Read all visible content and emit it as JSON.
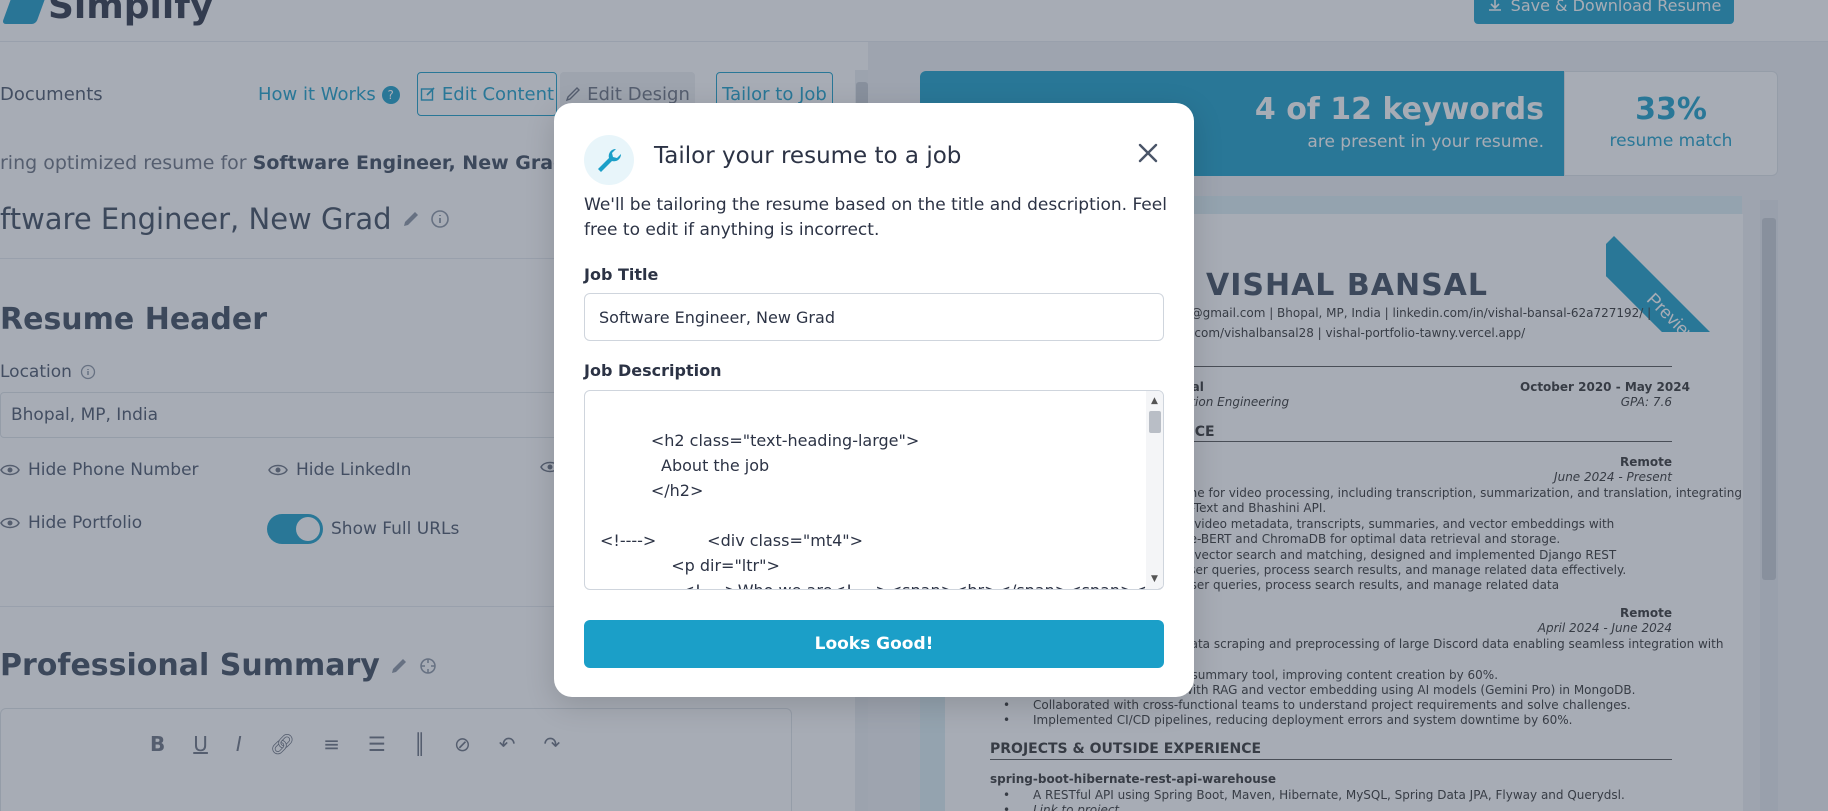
{
  "header": {
    "logo_text": "Simplify",
    "save_button": "Save & Download Resume"
  },
  "nav": {
    "documents": "Documents",
    "how_it_works": "How it Works",
    "help_badge": "?",
    "edit_content": "Edit Content",
    "edit_design": "Edit Design",
    "tailor_to_job": "Tailor to Job"
  },
  "editor": {
    "subtitle_prefix": "ring optimized resume for",
    "subtitle_job": "Software Engineer, New Grad",
    "job_heading": "ftware Engineer, New Grad",
    "resume_header_title": "Resume Header",
    "location_label": "Location",
    "location_value": "Bhopal, MP, India",
    "hide_phone": "Hide Phone Number",
    "hide_linkedin": "Hide LinkedIn",
    "hide_portfolio": "Hide Portfolio",
    "show_full_urls": "Show Full URLs",
    "professional_summary_title": "Professional Summary"
  },
  "keywords": {
    "count_text": "4 of 12 keywords",
    "count_sub": "are present in your resume.",
    "match_pct": "33%",
    "match_label": "resume match"
  },
  "preview": {
    "ribbon": "Preview",
    "name": "VISHAL BANSAL",
    "contact_line1": "b@gmail.com  |  Bhopal, MP, India  |  linkedin.com/in/vishal-bansal-62a727192/  |",
    "contact_line2": "b.com/vishalbansal28  |  vishal-portfolio-tawny.vercel.app/",
    "edu_school": "bal",
    "edu_degree": "ation Engineering",
    "edu_dates": "October 2020 - May 2024",
    "edu_gpa": "GPA: 7.6",
    "exp_heading": "NCE",
    "job1_location": "Remote",
    "job1_dates": "June 2024 - Present",
    "job1_b1": "line for video processing, including transcription, summarization, and translation, integrating",
    "job1_b1b": "o-Text and Bhashini API.",
    "job1_b2": "e video metadata, transcripts, summaries, and vector embeddings with",
    "job1_b2b": "ce-BERT and ChromaDB for optimal data retrieval and storage.",
    "job1_b3": "d vector search and matching, designed and implemented Django REST",
    "job1_b3b": "sser queries, process search results, and manage related data effectively.",
    "job1_b3c": "user queries, process search results, and manage related data",
    "job2_location": "Remote",
    "job2_dates": "April 2024 - June 2024",
    "job2_b1": "data scraping and preprocessing of large Discord data enabling seamless integration with",
    "job2_b2": "t summary tool, improving content creation by 60%.",
    "job2_b3": "with RAG and vector embedding using AI models (Gemini Pro) in MongoDB.",
    "job2_b4": "Collaborated with cross-functional teams to understand project requirements and solve challenges.",
    "job2_b5": "Implemented CI/CD pipelines, reducing deployment errors and system downtime by 60%.",
    "projects_heading": "PROJECTS & OUTSIDE EXPERIENCE",
    "project1_name": "spring-boot-hibernate-rest-api-warehouse",
    "project1_b1": "A RESTful API using Spring Boot, Maven, Hibernate, MySQL, Spring Data JPA, Flyway and Querydsl.",
    "project1_b2": "Link to project"
  },
  "modal": {
    "title": "Tailor your resume to a job",
    "description": "We'll be tailoring the resume based on the title and description. Feel free to edit if anything is incorrect.",
    "job_title_label": "Job Title",
    "job_title_value": "Software Engineer, New Grad",
    "job_description_label": "Job Description",
    "job_description_value": "\n          <h2 class=\"text-heading-large\">\n            About the job\n          </h2>\n\n<!---->          <div class=\"mt4\">\n              <p dir=\"ltr\">\n                <!---->Who we are<!----><span><br></span><span><br>",
    "confirm_button": "Looks Good!"
  },
  "colors": {
    "accent": "#1b9fc8",
    "overlay": "rgba(60,70,90,0.45)"
  },
  "icons": {
    "modal_icon": "wrench-icon",
    "close": "close-icon"
  }
}
